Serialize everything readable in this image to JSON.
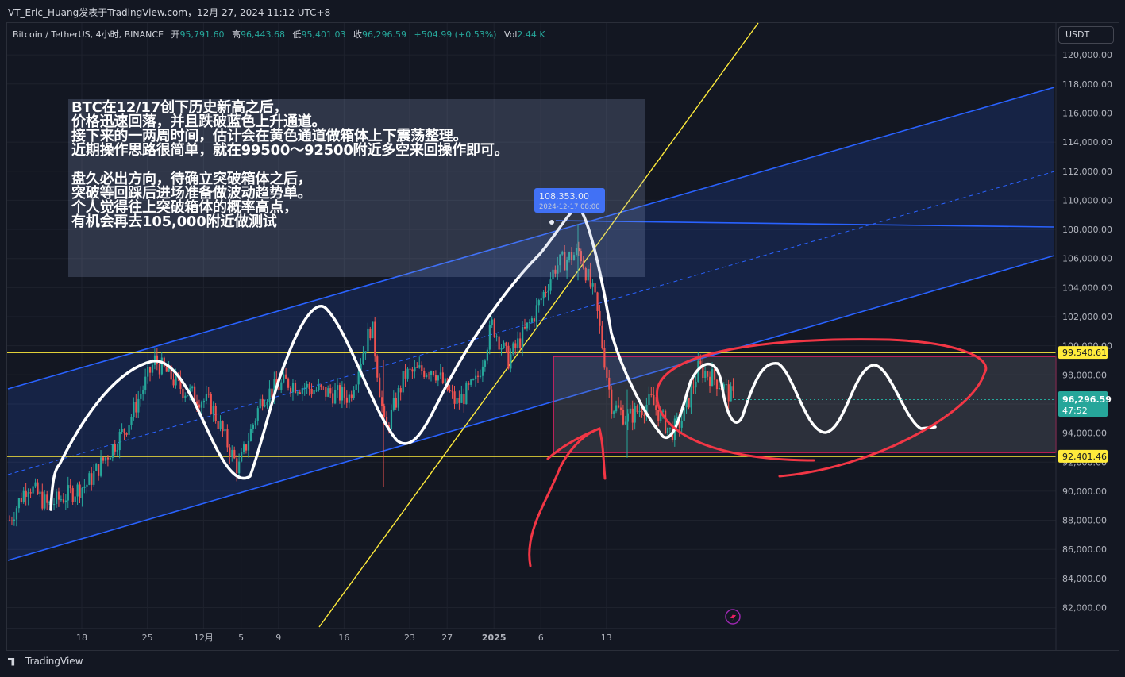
{
  "publisher_line": "VT_Eric_Huang发表于TradingView.com，12月 27, 2024 11:12 UTC+8",
  "legend": {
    "symbol": "Bitcoin / TetherUS, 4小时, BINANCE",
    "open_label": "开",
    "open": "95,791.60",
    "high_label": "高",
    "high": "96,443.68",
    "low_label": "低",
    "low": "95,401.03",
    "close_label": "收",
    "close": "96,296.59",
    "change": "+504.99 (+0.53%)",
    "vol_label": "Vol",
    "vol": "2.44 K"
  },
  "currency": "USDT",
  "annotation": {
    "lines": [
      "BTC在12/17创下历史新高之后，",
      "价格迅速回落，并且跌破蓝色上升通道。",
      "接下来的一两周时间，估计会在黄色通道做箱体上下震荡整理。",
      "近期操作思路很简单，就在99500～92500附近多空来回操作即可。",
      "",
      "盘久必出方向，待确立突破箱体之后，",
      "突破等回踩后进场准备做波动趋势单。",
      "个人觉得往上突破箱体的概率高点，",
      "有机会再去105,000附近做测试"
    ]
  },
  "chart_data": {
    "type": "candlestick",
    "timeframe": "4小时",
    "y_axis": {
      "ticks": [
        82000,
        84000,
        86000,
        88000,
        90000,
        92000,
        94000,
        96000,
        98000,
        100000,
        102000,
        104000,
        106000,
        108000,
        110000,
        112000,
        114000,
        116000,
        118000,
        120000
      ],
      "tick_labels": [
        "82,000.00",
        "84,000.00",
        "86,000.00",
        "88,000.00",
        "90,000.00",
        "92,000.00",
        "94,000.00",
        "96,000.00",
        "98,000.00",
        "100,000.00",
        "102,000.00",
        "104,000.00",
        "106,000.00",
        "108,000.00",
        "110,000.00",
        "112,000.00",
        "114,000.00",
        "116,000.00",
        "118,000.00",
        "120,000.00"
      ],
      "range": [
        81000,
        122000
      ]
    },
    "x_axis": {
      "tick_labels": [
        "18",
        "25",
        "12月",
        "5",
        "9",
        "16",
        "23",
        "27",
        "2025",
        "6",
        "13"
      ],
      "tick_dates": [
        "2024-11-18",
        "2024-11-25",
        "2024-12-01",
        "2024-12-05",
        "2024-12-09",
        "2024-12-16",
        "2024-12-23",
        "2024-12-27",
        "2025-01-01",
        "2025-01-06",
        "2025-01-13"
      ]
    },
    "price_labels": {
      "resistance": "99,540.61",
      "support": "92,401.46",
      "last": "96,296.59",
      "countdown": "47:52"
    },
    "high_marker": {
      "price": "108,353.00",
      "date": "2024-12-17 08:00"
    },
    "levels": {
      "resistance": 99540.61,
      "support": 92401.46,
      "last": 96296.59
    },
    "colors": {
      "up": "#26a69a",
      "down": "#ef5350",
      "channel": "#2962ff",
      "level": "#ffeb3b",
      "box": "#e91e63",
      "drawing": "#f23645"
    }
  },
  "footer": {
    "brand": "TradingView"
  }
}
